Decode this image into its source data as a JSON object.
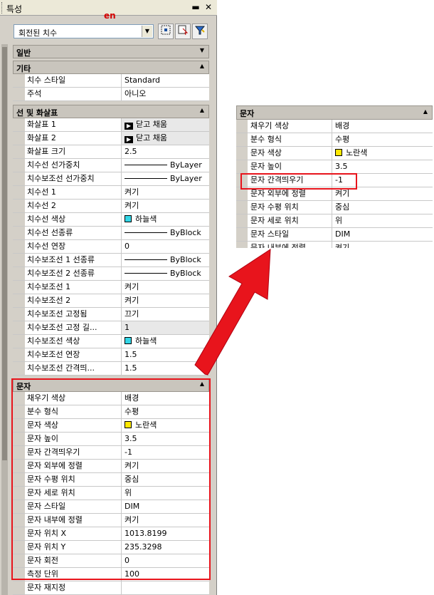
{
  "window": {
    "title": "특성",
    "lang_tag": "en"
  },
  "colors": {
    "highlight": "#e8141c",
    "cyan": "#33d6e6",
    "yellow": "#ffe800"
  },
  "selector": {
    "value": "회전된 치수"
  },
  "sections": {
    "general": "일반",
    "misc": "기타",
    "lines": "선 및 화살표",
    "text": "문자"
  },
  "misc_rows": [
    {
      "name": "치수 스타일",
      "value": "Standard"
    },
    {
      "name": "주석",
      "value": "아니오"
    }
  ],
  "line_rows": [
    {
      "name": "화살표 1",
      "value": "닫고 채움"
    },
    {
      "name": "화살표 2",
      "value": "닫고 채움"
    },
    {
      "name": "화살표 크기",
      "value": "2.5"
    },
    {
      "name": "치수선 선가중치",
      "value": "ByLayer"
    },
    {
      "name": "치수보조선 선가중치",
      "value": "ByLayer"
    },
    {
      "name": "치수선 1",
      "value": "켜기"
    },
    {
      "name": "치수선 2",
      "value": "켜기"
    },
    {
      "name": "치수선 색상",
      "value": "하늘색"
    },
    {
      "name": "치수선 선종류",
      "value": "ByBlock"
    },
    {
      "name": "치수선 연장",
      "value": "0"
    },
    {
      "name": "치수보조선 1 선종류",
      "value": "ByBlock"
    },
    {
      "name": "치수보조선 2 선종류",
      "value": "ByBlock"
    },
    {
      "name": "치수보조선 1",
      "value": "켜기"
    },
    {
      "name": "치수보조선 2",
      "value": "켜기"
    },
    {
      "name": "치수보조선 고정됨",
      "value": "끄기"
    },
    {
      "name": "치수보조선 고정 길...",
      "value": "1"
    },
    {
      "name": "치수보조선 색상",
      "value": "하늘색"
    },
    {
      "name": "치수보조선 연장",
      "value": "1.5"
    },
    {
      "name": "치수보조선 간격띄...",
      "value": "1.5"
    }
  ],
  "text_rows": [
    {
      "name": "채우기 색상",
      "value": "배경"
    },
    {
      "name": "분수 형식",
      "value": "수평"
    },
    {
      "name": "문자 색상",
      "value": "노란색"
    },
    {
      "name": "문자 높이",
      "value": "3.5"
    },
    {
      "name": "문자 간격띄우기",
      "value": "-1"
    },
    {
      "name": "문자 외부에 정렬",
      "value": "켜기"
    },
    {
      "name": "문자 수평 위치",
      "value": "중심"
    },
    {
      "name": "문자 세로 위치",
      "value": "위"
    },
    {
      "name": "문자 스타일",
      "value": "DIM"
    },
    {
      "name": "문자 내부에 정렬",
      "value": "켜기"
    },
    {
      "name": "문자 위치 X",
      "value": "1013.8199"
    },
    {
      "name": "문자 위치 Y",
      "value": "235.3298"
    },
    {
      "name": "문자 회전",
      "value": "0"
    },
    {
      "name": "측정 단위",
      "value": "100"
    },
    {
      "name": "문자 재지정",
      "value": ""
    }
  ],
  "zoom_panel": {
    "title": "문자",
    "rows": [
      {
        "name": "채우기 색상",
        "value": "배경"
      },
      {
        "name": "분수 형식",
        "value": "수평"
      },
      {
        "name": "문자 색상",
        "value": "노란색"
      },
      {
        "name": "문자 높이",
        "value": "3.5"
      },
      {
        "name": "문자 간격띄우기",
        "value": "-1"
      },
      {
        "name": "문자 외부에 정렬",
        "value": "켜기"
      },
      {
        "name": "문자 수평 위치",
        "value": "중심"
      },
      {
        "name": "문자 세로 위치",
        "value": "위"
      },
      {
        "name": "문자 스타일",
        "value": "DIM"
      },
      {
        "name": "문자 내부에 정렬",
        "value": "켜기"
      }
    ]
  }
}
